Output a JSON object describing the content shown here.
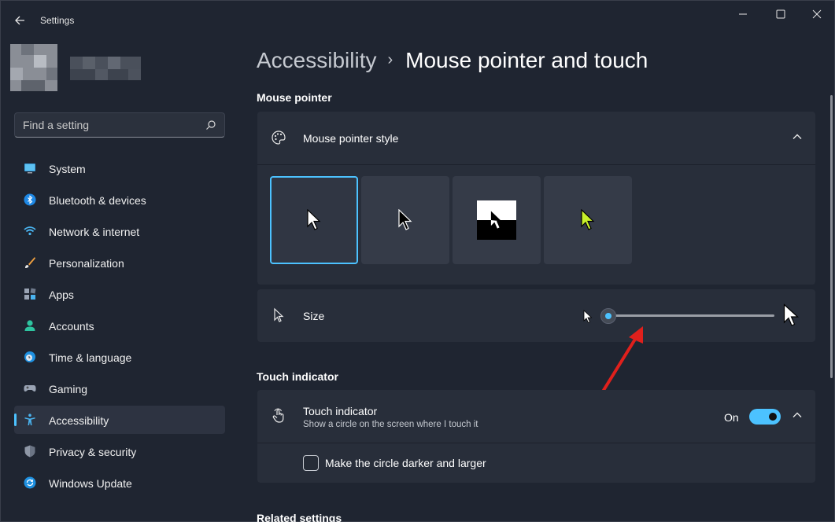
{
  "window": {
    "title": "Settings"
  },
  "search": {
    "placeholder": "Find a setting"
  },
  "sidebar": {
    "items": [
      {
        "label": "System",
        "icon": "monitor-icon",
        "active": false
      },
      {
        "label": "Bluetooth & devices",
        "icon": "bluetooth-icon",
        "active": false
      },
      {
        "label": "Network & internet",
        "icon": "wifi-icon",
        "active": false
      },
      {
        "label": "Personalization",
        "icon": "brush-icon",
        "active": false
      },
      {
        "label": "Apps",
        "icon": "apps-icon",
        "active": false
      },
      {
        "label": "Accounts",
        "icon": "person-icon",
        "active": false
      },
      {
        "label": "Time & language",
        "icon": "globe-clock-icon",
        "active": false
      },
      {
        "label": "Gaming",
        "icon": "gamepad-icon",
        "active": false
      },
      {
        "label": "Accessibility",
        "icon": "accessibility-icon",
        "active": true
      },
      {
        "label": "Privacy & security",
        "icon": "shield-icon",
        "active": false
      },
      {
        "label": "Windows Update",
        "icon": "update-icon",
        "active": false
      }
    ]
  },
  "breadcrumb": {
    "parent": "Accessibility",
    "separator": "›",
    "current": "Mouse pointer and touch"
  },
  "mouse_pointer": {
    "section_title": "Mouse pointer",
    "style_label": "Mouse pointer style",
    "styles": [
      "white",
      "black",
      "inverted",
      "custom"
    ],
    "selected_style": "white",
    "custom_color": "#c8f02a",
    "size_label": "Size",
    "size_value": 1
  },
  "touch": {
    "section_title": "Touch indicator",
    "title": "Touch indicator",
    "description": "Show a circle on the screen where I touch it",
    "toggle_state_label": "On",
    "toggle_on": true,
    "darker_label": "Make the circle darker and larger",
    "darker_checked": false
  },
  "related": {
    "section_title": "Related settings"
  },
  "colors": {
    "accent": "#4cc2ff",
    "annotation_arrow": "#e0201c"
  }
}
